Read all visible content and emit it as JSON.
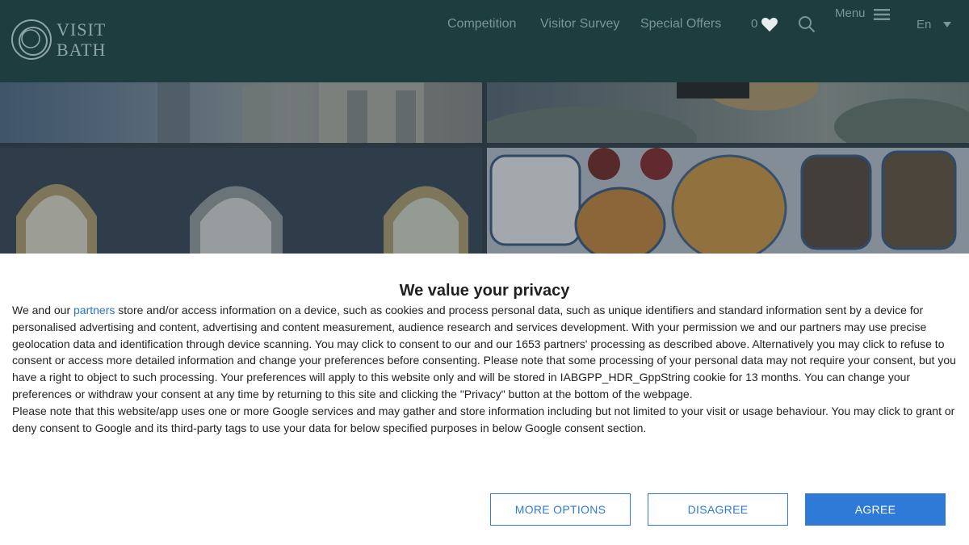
{
  "header": {
    "logo_line1": "VISIT",
    "logo_line2": "BATH",
    "nav": [
      {
        "label": "Competition"
      },
      {
        "label": "Visitor Survey"
      },
      {
        "label": "Special Offers"
      }
    ],
    "favourites_count": "0",
    "menu_label": "Menu",
    "language": "En"
  },
  "consent": {
    "title": "We value your privacy",
    "para1_prefix": "We and our ",
    "para1_link": "partners",
    "para1_rest": " store and/or access information on a device, such as cookies and process personal data, such as unique identifiers and standard information sent by a device for personalised advertising and content, advertising and content measurement, audience research and services development. With your permission we and our partners may use precise geolocation data and identification through device scanning. You may click to consent to our and our 1653 partners' processing as described above. Alternatively you may click to refuse to consent or access more detailed information and change your preferences before consenting. Please note that some processing of your personal data may not require your consent, but you have a right to object to such processing. Your preferences will apply to this website only and will be stored in IABGPP_HDR_GppString cookie for 13 months. You can change your preferences or withdraw your consent at any time by returning to this site and clicking the \"Privacy\" button at the bottom of the webpage.",
    "para2": "Please note that this website/app uses one or more Google services and may gather and store information including but not limited to your visit or usage behaviour. You may click to grant or deny consent to Google and its third-party tags to use your data for below specified purposes in below Google consent section.",
    "buttons": {
      "more_options": "MORE OPTIONS",
      "disagree": "DISAGREE",
      "agree": "AGREE"
    }
  },
  "colors": {
    "header_bg": "#1d3d3f",
    "accent_blue": "#2f7ad6",
    "link_blue": "#2b72c2"
  },
  "icons": [
    "logo-rings-icon",
    "heart-icon",
    "search-icon",
    "hamburger-icon",
    "caret-down-icon"
  ]
}
